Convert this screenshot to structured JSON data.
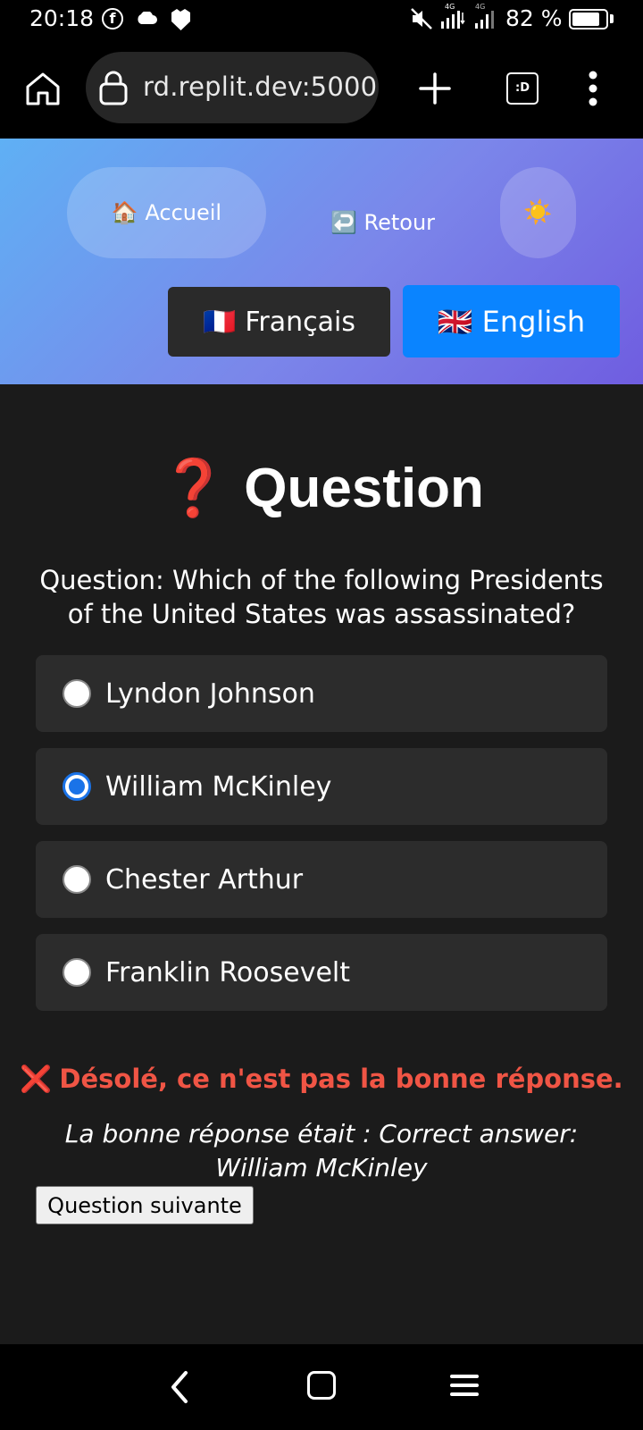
{
  "status_bar": {
    "time": "20:18",
    "battery_text": "82 %",
    "battery_level": 0.82,
    "icons": [
      "facebook-icon",
      "cloud-icon",
      "shield-icon",
      "mute-icon",
      "signal-4g-icon",
      "signal-4g-icon",
      "battery-icon"
    ],
    "network_label": "4G"
  },
  "browser": {
    "url": "rd.replit.dev:5000",
    "tabs_label": ":D",
    "icons": [
      "home-icon",
      "lock-icon",
      "plus-icon",
      "tabs-icon",
      "more-vertical-icon"
    ]
  },
  "header": {
    "home_label": "🏠 Accueil",
    "back_label": "↩️ Retour",
    "theme_icon": "☀️",
    "lang_fr": {
      "flag": "🇫🇷",
      "label": "Français"
    },
    "lang_en": {
      "flag": "🇬🇧",
      "label": "English"
    },
    "accent_active": "#0a84ff"
  },
  "quiz": {
    "title_icon": "❓",
    "title": "Question",
    "question": "Question: Which of the following Presidents of the United States was assassinated?",
    "options": [
      {
        "label": "Lyndon Johnson",
        "selected": false
      },
      {
        "label": "William McKinley",
        "selected": true
      },
      {
        "label": "Chester Arthur",
        "selected": false
      },
      {
        "label": "Franklin Roosevelt",
        "selected": false
      }
    ],
    "result_icon": "❌",
    "result_text": "Désolé, ce n'est pas la bonne réponse.",
    "correct_answer_text": "La bonne réponse était : Correct answer: William McKinley",
    "next_button": "Question suivante",
    "error_color": "#f05545"
  },
  "nav_bar": {
    "icons": [
      "back-icon",
      "home-square-icon",
      "recents-menu-icon"
    ]
  }
}
